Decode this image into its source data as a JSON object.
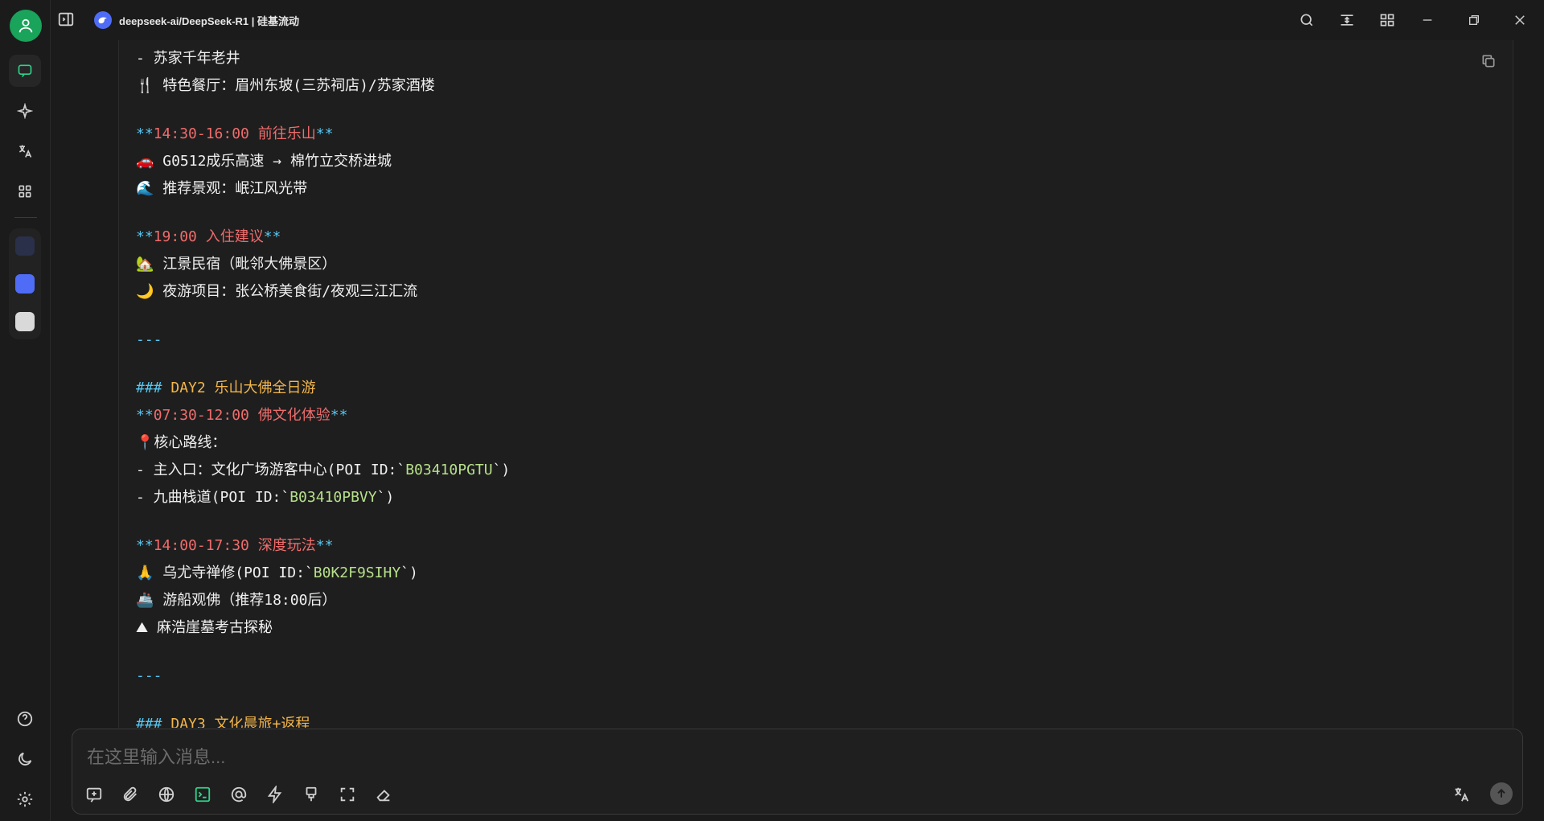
{
  "window": {
    "title": "deepseek-ai/DeepSeek-R1 | 硅基流动"
  },
  "message": {
    "lines": [
      {
        "type": "text",
        "segments": [
          {
            "t": "- 苏家千年老井",
            "c": ""
          }
        ]
      },
      {
        "type": "text",
        "segments": [
          {
            "t": "🍴 特色餐厅：眉州东坡(三苏祠店)/苏家酒楼",
            "c": ""
          }
        ]
      },
      {
        "type": "blank"
      },
      {
        "type": "text",
        "segments": [
          {
            "t": "**",
            "c": "k"
          },
          {
            "t": "14:30-16:00 前往乐山",
            "c": "t"
          },
          {
            "t": "**",
            "c": "k"
          }
        ]
      },
      {
        "type": "text",
        "segments": [
          {
            "t": "🚗 ",
            "c": ""
          },
          {
            "t": "G0512成乐高速 → 棉竹立交桥进城",
            "c": ""
          }
        ]
      },
      {
        "type": "text",
        "segments": [
          {
            "t": "🌊 推荐景观：岷江风光带",
            "c": ""
          }
        ]
      },
      {
        "type": "blank"
      },
      {
        "type": "text",
        "segments": [
          {
            "t": "**",
            "c": "k"
          },
          {
            "t": "19:00 入住建议",
            "c": "t"
          },
          {
            "t": "**",
            "c": "k"
          }
        ]
      },
      {
        "type": "text",
        "segments": [
          {
            "t": "🏡 江景民宿（毗邻大佛景区）",
            "c": ""
          }
        ]
      },
      {
        "type": "text",
        "segments": [
          {
            "t": "🌙 夜游项目：张公桥美食街/夜观三江汇流",
            "c": ""
          }
        ]
      },
      {
        "type": "blank"
      },
      {
        "type": "text",
        "segments": [
          {
            "t": "---",
            "c": "dash"
          }
        ]
      },
      {
        "type": "blank"
      },
      {
        "type": "text",
        "segments": [
          {
            "t": "### ",
            "c": "k"
          },
          {
            "t": "DAY2 乐山大佛全日游",
            "c": "h"
          }
        ]
      },
      {
        "type": "text",
        "segments": [
          {
            "t": "**",
            "c": "k"
          },
          {
            "t": "07:30-12:00 佛文化体验",
            "c": "t"
          },
          {
            "t": "**",
            "c": "k"
          }
        ]
      },
      {
        "type": "text",
        "segments": [
          {
            "t": "📍核心路线：",
            "c": ""
          }
        ]
      },
      {
        "type": "text",
        "segments": [
          {
            "t": "- 主入口：文化广场游客中心(POI ID:`",
            "c": ""
          },
          {
            "t": "B03410PGTU",
            "c": "code"
          },
          {
            "t": "`)",
            "c": ""
          }
        ]
      },
      {
        "type": "text",
        "segments": [
          {
            "t": "- 九曲栈道(POI ID:`",
            "c": ""
          },
          {
            "t": "B03410PBVY",
            "c": "code"
          },
          {
            "t": "`)",
            "c": ""
          }
        ]
      },
      {
        "type": "blank"
      },
      {
        "type": "text",
        "segments": [
          {
            "t": "**",
            "c": "k"
          },
          {
            "t": "14:00-17:30 深度玩法",
            "c": "t"
          },
          {
            "t": "**",
            "c": "k"
          }
        ]
      },
      {
        "type": "text",
        "segments": [
          {
            "t": "🙏 乌尤寺禅修(POI ID:`",
            "c": ""
          },
          {
            "t": "B0K2F9SIHY",
            "c": "code"
          },
          {
            "t": "`)",
            "c": ""
          }
        ]
      },
      {
        "type": "text",
        "segments": [
          {
            "t": "🚢 游船观佛（推荐18:00后）",
            "c": ""
          }
        ]
      },
      {
        "type": "text",
        "segments": [
          {
            "t": "⛰ 麻浩崖墓考古探秘",
            "c": ""
          }
        ]
      },
      {
        "type": "blank"
      },
      {
        "type": "text",
        "segments": [
          {
            "t": "---",
            "c": "dash"
          }
        ]
      },
      {
        "type": "blank"
      },
      {
        "type": "text",
        "segments": [
          {
            "t": "### ",
            "c": "k"
          },
          {
            "t": "DAY3 文化晨旅+返程",
            "c": "h"
          }
        ]
      }
    ]
  },
  "composer": {
    "placeholder": "在这里输入消息..."
  },
  "colors": {
    "accent": "#2fd38a",
    "time_heading": "#ef6c6c",
    "section_heading": "#f3b64b",
    "markdown_punct": "#56c6f0",
    "inline_code": "#b7e08a"
  },
  "icons": {
    "rail": [
      "user-avatar-icon",
      "chat-icon",
      "sparkle-icon",
      "translate-icon",
      "apps-grid-icon",
      "help-icon",
      "moon-icon",
      "settings-icon"
    ],
    "titlebar": [
      "search-icon",
      "expand-icon",
      "grid-icon",
      "minimize-icon",
      "restore-icon",
      "close-icon"
    ],
    "composer": [
      "new-topic-icon",
      "attach-icon",
      "globe-icon",
      "terminal-icon",
      "mention-icon",
      "bolt-icon",
      "brush-icon",
      "fullscreen-icon",
      "eraser-icon",
      "translate-icon",
      "send-icon"
    ]
  }
}
